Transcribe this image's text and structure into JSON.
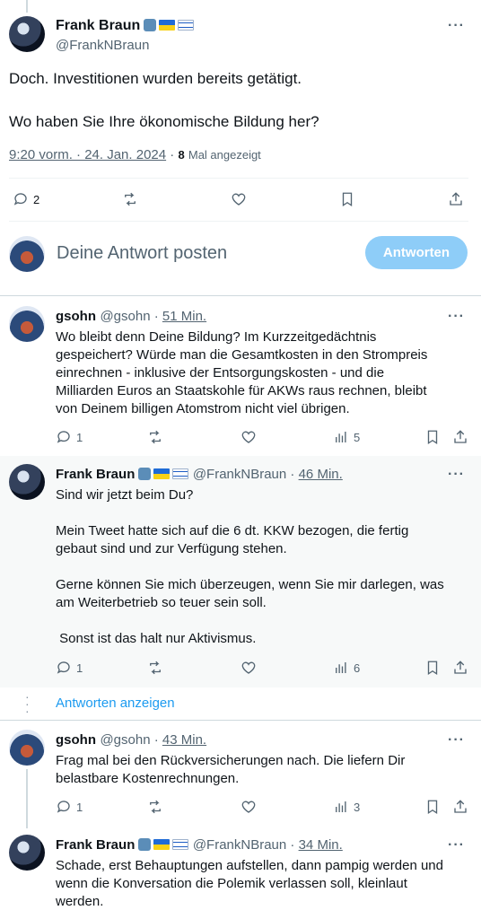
{
  "main_tweet": {
    "name": "Frank Braun",
    "handle": "@FrankNBraun",
    "text": "Doch. Investitionen wurden bereits getätigt.\n\nWo haben Sie Ihre ökonomische Bildung her?",
    "timestamp": "9:20 vorm. · 24. Jan. 2024",
    "view_count": "8",
    "view_label": "Mal angezeigt",
    "replies": "2"
  },
  "compose": {
    "placeholder": "Deine Antwort posten",
    "button": "Antworten"
  },
  "replies": [
    {
      "name": "gsohn",
      "handle": "@gsohn",
      "time": "51 Min.",
      "text": "Wo bleibt denn Deine Bildung? Im Kurzzeitgedächtnis\ngespeichert? Würde man die Gesamtkosten in den Strompreis\neinrechnen - inklusive der Entsorgungskosten - und die\nMilliarden Euros an Staatskohle für AKWs raus rechnen, bleibt\nvon Deinem billigen Atomstrom nicht viel übrigen.",
      "replies": "1",
      "views": "5"
    },
    {
      "name": "Frank Braun",
      "handle": "@FrankNBraun",
      "time": "46 Min.",
      "text": "Sind wir jetzt beim Du?\n\nMein Tweet hatte sich auf die 6 dt. KKW bezogen, die fertig\ngebaut sind und zur Verfügung stehen.\n\nGerne können Sie mich überzeugen, wenn Sie mir darlegen, was\nam Weiterbetrieb so teuer sein soll.\n\n Sonst ist das halt nur Aktivismus.",
      "replies": "1",
      "views": "6"
    },
    {
      "name": "gsohn",
      "handle": "@gsohn",
      "time": "43 Min.",
      "text": "Frag mal bei den Rückversicherungen nach. Die liefern Dir\nbelastbare Kostenrechnungen.",
      "replies": "1",
      "views": "3"
    },
    {
      "name": "Frank Braun",
      "handle": "@FrankNBraun",
      "time": "34 Min.",
      "text": "Schade, erst Behauptungen aufstellen, dann pampig werden und\nwenn die Konversation die Polemik verlassen soll, kleinlaut\nwerden."
    }
  ],
  "show_replies": "Antworten anzeigen",
  "colors": {
    "highlight_bg": "#f7f9f9",
    "button_bg": "#8ecdf8",
    "link": "#1d9bf0",
    "muted": "#536471"
  }
}
